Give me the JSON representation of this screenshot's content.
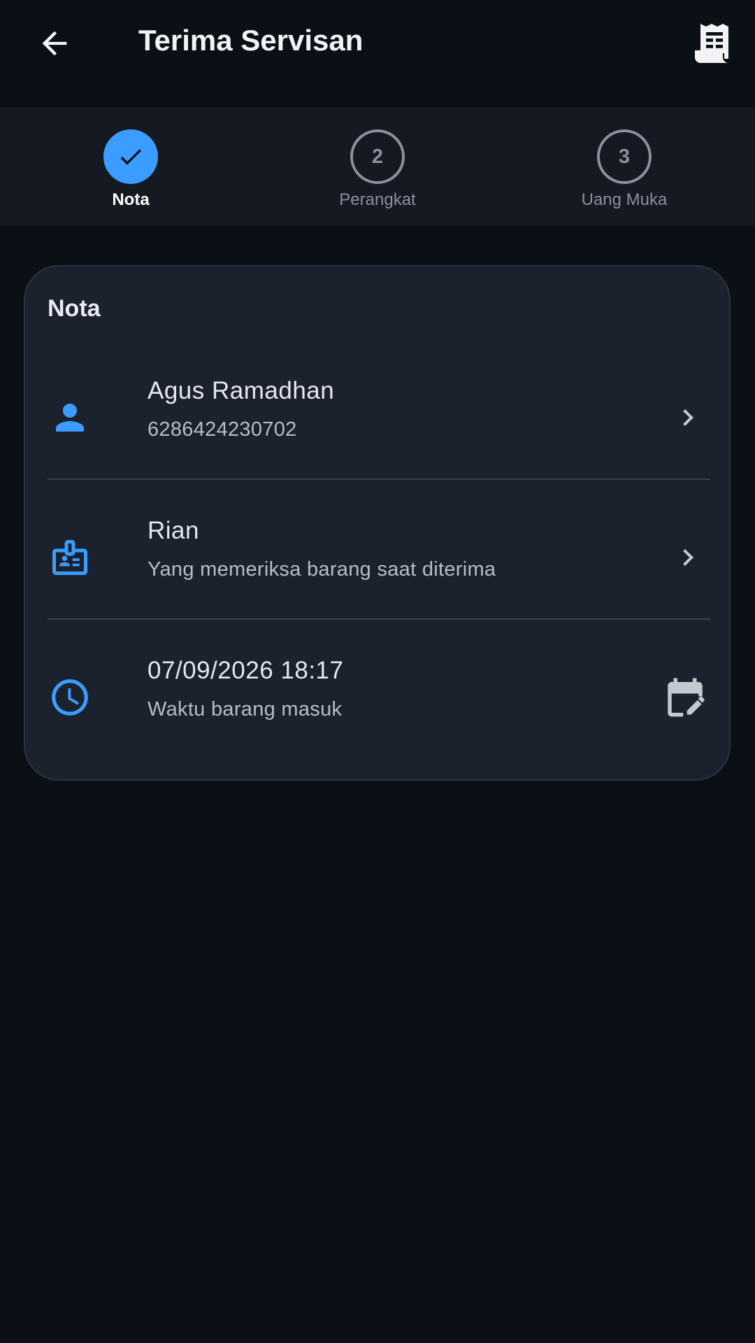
{
  "appbar": {
    "title": "Terima Servisan",
    "back_icon": "arrow-left-icon",
    "action_icon": "receipt-icon"
  },
  "stepper": {
    "steps": [
      {
        "number": "1",
        "label": "Nota",
        "state": "completed"
      },
      {
        "number": "2",
        "label": "Perangkat",
        "state": "inactive"
      },
      {
        "number": "3",
        "label": "Uang Muka",
        "state": "inactive"
      }
    ]
  },
  "card": {
    "title": "Nota",
    "rows": [
      {
        "icon": "person-icon",
        "primary": "Agus Ramadhan",
        "secondary": "6286424230702",
        "trailing_icon": "chevron-right-icon"
      },
      {
        "icon": "badge-icon",
        "primary": "Rian",
        "secondary": "Yang memeriksa barang saat diterima",
        "trailing_icon": "chevron-right-icon"
      },
      {
        "icon": "clock-icon",
        "primary": "07/09/2026 18:17",
        "secondary": "Waktu barang masuk",
        "trailing_icon": "calendar-edit-icon"
      }
    ]
  },
  "colors": {
    "background": "#0b0f16",
    "surface": "#1b222d",
    "stepper_bg": "#151a22",
    "accent": "#3b9dff",
    "muted": "#8b919c"
  }
}
